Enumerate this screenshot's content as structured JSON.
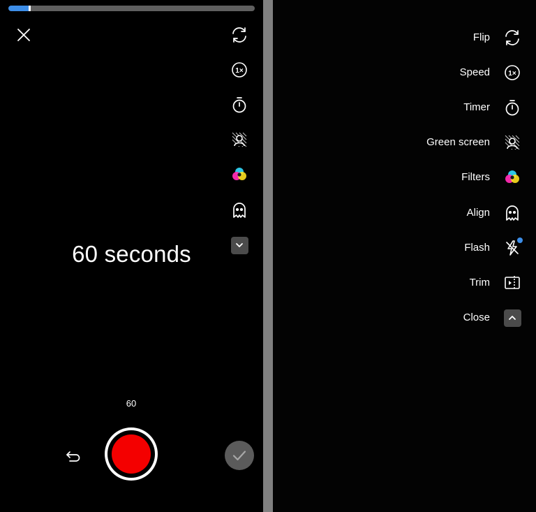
{
  "left_panel": {
    "progress": {
      "fraction": 0.085,
      "color": "#3d8ee8"
    },
    "icons": {
      "close": "close-icon",
      "flip": "flip-camera-icon",
      "speed": "speed-1x-icon",
      "timer": "timer-icon",
      "green_screen": "green-screen-icon",
      "filters": "filters-icon",
      "align": "align-ghost-icon",
      "expand": "chevron-down-icon",
      "undo": "undo-icon",
      "done": "checkmark-icon"
    },
    "duration_label": "60 seconds",
    "time_counter": "60",
    "record_color": "#f40000"
  },
  "right_panel": {
    "menu": [
      {
        "label": "Flip",
        "icon": "flip-camera-icon"
      },
      {
        "label": "Speed",
        "icon": "speed-1x-icon"
      },
      {
        "label": "Timer",
        "icon": "timer-icon"
      },
      {
        "label": "Green screen",
        "icon": "green-screen-icon"
      },
      {
        "label": "Filters",
        "icon": "filters-icon"
      },
      {
        "label": "Align",
        "icon": "align-ghost-icon"
      },
      {
        "label": "Flash",
        "icon": "flash-off-icon",
        "badge": true
      },
      {
        "label": "Trim",
        "icon": "trim-icon"
      },
      {
        "label": "Close",
        "icon": "chevron-up-icon"
      }
    ]
  }
}
